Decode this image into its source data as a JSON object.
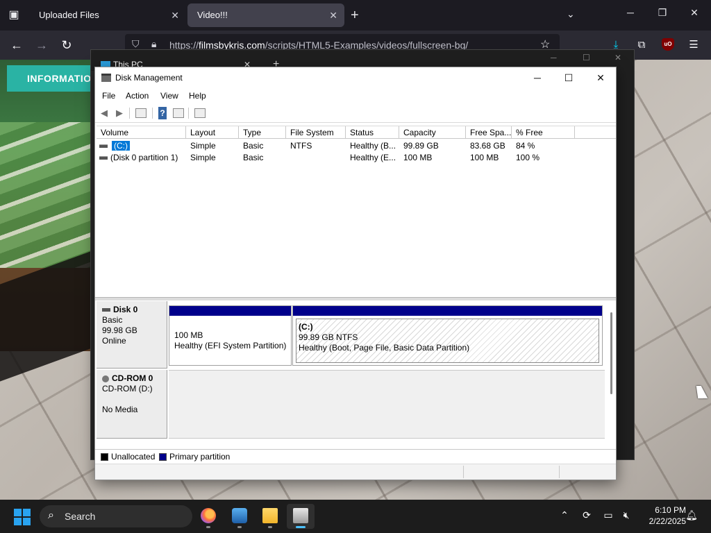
{
  "browser": {
    "tabs": [
      {
        "title": "Uploaded Files",
        "active": false
      },
      {
        "title": "Video!!!",
        "active": true
      }
    ],
    "url_prefix": "https://",
    "url_host": "filmsbykris.com",
    "url_path": "/scripts/HTML5-Examples/videos/fullscreen-bg/",
    "ublock_label": "uO",
    "icons": {
      "tab_list": "tab-list-icon",
      "new_tab": "plus-icon",
      "overflow": "chevron-down-icon",
      "back": "arrow-left-icon",
      "forward": "arrow-right-icon",
      "reload": "reload-icon",
      "shield": "shield-icon",
      "lock": "lock-icon",
      "star": "star-icon",
      "download": "download-icon",
      "extensions": "puzzle-icon",
      "menu": "hamburger-icon"
    }
  },
  "website": {
    "button_label": "INFORMATIO"
  },
  "thispc_window": {
    "title": "This PC"
  },
  "disk_management": {
    "title": "Disk Management",
    "menu": [
      "File",
      "Action",
      "View",
      "Help"
    ],
    "columns": [
      "Volume",
      "Layout",
      "Type",
      "File System",
      "Status",
      "Capacity",
      "Free Spa...",
      "% Free"
    ],
    "volumes": [
      {
        "volume": "(C:)",
        "layout": "Simple",
        "type": "Basic",
        "file_system": "NTFS",
        "status": "Healthy (B...",
        "capacity": "99.89 GB",
        "free_space": "83.68 GB",
        "percent_free": "84 %",
        "selected": true
      },
      {
        "volume": "(Disk 0 partition 1)",
        "layout": "Simple",
        "type": "Basic",
        "file_system": "",
        "status": "Healthy (E...",
        "capacity": "100 MB",
        "free_space": "100 MB",
        "percent_free": "100 %",
        "selected": false
      }
    ],
    "disks": [
      {
        "name": "Disk 0",
        "type": "Basic",
        "size": "99.98 GB",
        "state": "Online",
        "partitions": [
          {
            "label": "",
            "size": "100 MB",
            "status": "Healthy (EFI System Partition)"
          },
          {
            "label": "(C:)",
            "size": "99.89 GB NTFS",
            "status": "Healthy (Boot, Page File, Basic Data Partition)"
          }
        ]
      },
      {
        "name": "CD-ROM 0",
        "drive": "CD-ROM (D:)",
        "media": "No Media"
      }
    ],
    "legend": [
      {
        "label": "Unallocated",
        "color": "#000000"
      },
      {
        "label": "Primary partition",
        "color": "#00008b"
      }
    ]
  },
  "taskbar": {
    "search_label": "Search",
    "time": "6:10 PM",
    "date": "2/22/2025",
    "apps": [
      "firefox-icon",
      "task-manager-icon",
      "file-explorer-icon",
      "disk-management-icon"
    ]
  }
}
